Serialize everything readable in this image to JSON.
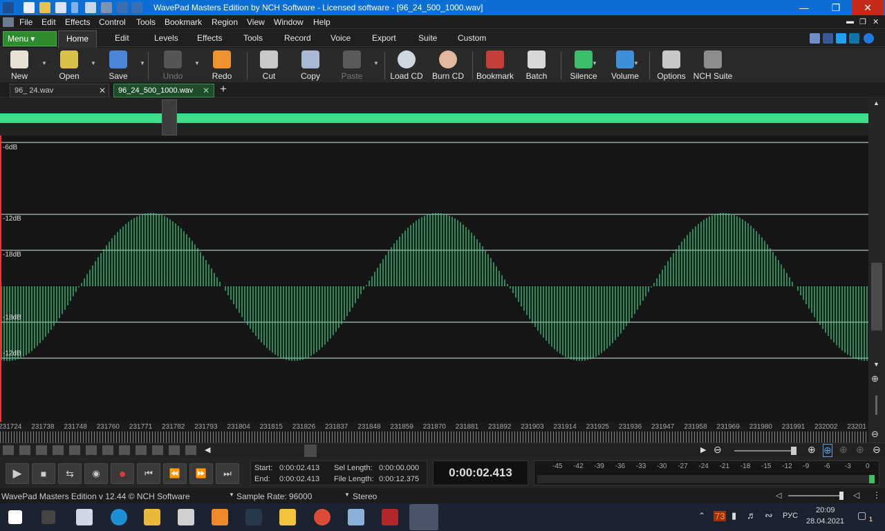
{
  "window": {
    "title": "WavePad Masters Edition by NCH Software - Licensed software - [96_24_500_1000.wav]"
  },
  "menubar": [
    "File",
    "Edit",
    "Effects",
    "Control",
    "Tools",
    "Bookmark",
    "Region",
    "View",
    "Window",
    "Help"
  ],
  "ribbon": {
    "menu_label": "Menu",
    "tabs": [
      "Home",
      "Edit",
      "Levels",
      "Effects",
      "Tools",
      "Record",
      "Voice",
      "Export",
      "Suite",
      "Custom"
    ]
  },
  "toolbar": {
    "new": "New",
    "open": "Open",
    "save": "Save",
    "undo": "Undo",
    "redo": "Redo",
    "cut": "Cut",
    "copy": "Copy",
    "paste": "Paste",
    "load_cd": "Load CD",
    "burn_cd": "Burn CD",
    "bookmark": "Bookmark",
    "batch": "Batch",
    "silence": "Silence",
    "volume": "Volume",
    "options": "Options",
    "nch_suite": "NCH Suite"
  },
  "files": {
    "tabs": [
      "96_ 24.wav",
      "96_24_500_1000.wav"
    ],
    "add": "+"
  },
  "waveform": {
    "db_labels": [
      "-6dB",
      "-12dB",
      "-18dB",
      "-18dB",
      "-12dB"
    ],
    "wave_color": "#4be397",
    "bar_color": "#3ddb8a"
  },
  "ruler": {
    "ticks": [
      "231724",
      "231738",
      "231748",
      "231760",
      "231771",
      "231782",
      "231793",
      "231804",
      "231815",
      "231826",
      "231837",
      "231848",
      "231859",
      "231870",
      "231881",
      "231892",
      "231903",
      "231914",
      "231925",
      "231936",
      "231947",
      "231958",
      "231969",
      "231980",
      "231991",
      "232002",
      "23201"
    ]
  },
  "info": {
    "start_label": "Start:",
    "start": "0:00:02.413",
    "end_label": "End:",
    "end": "0:00:02.413",
    "sel_label": "Sel Length:",
    "sel": "0:00:00.000",
    "file_label": "File Length:",
    "file": "0:00:12.375",
    "time": "0:00:02.413"
  },
  "meter": {
    "scale": [
      "-45",
      "-42",
      "-39",
      "-36",
      "-33",
      "-30",
      "-27",
      "-24",
      "-21",
      "-18",
      "-15",
      "-12",
      "-9",
      "-6",
      "-3",
      "0"
    ]
  },
  "status": {
    "version": "WavePad Masters Edition v 12.44 © NCH Software",
    "sample_rate": "Sample Rate: 96000",
    "channels": "Stereo"
  },
  "taskbar": {
    "time": "20:09",
    "date": "28.04.2021",
    "lang": "РУС",
    "temp": "73",
    "notif": "1"
  }
}
